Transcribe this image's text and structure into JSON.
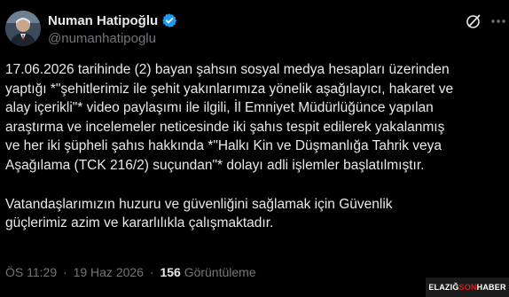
{
  "author": {
    "display_name": "Numan Hatipoğlu",
    "handle": "@numanhatipoglu",
    "verified_icon": "verified-badge-icon",
    "avatar": "profile-photo"
  },
  "actions": {
    "grok_icon": "grok-slash-circle-icon",
    "more_icon": "more-dots-icon"
  },
  "tweet": {
    "paragraph1": [
      "17.06.2026 tarihinde (2) bayan şahsın sosyal medya hesapları üzerinden",
      "yaptığı *\"şehitlerimiz ile şehit yakınlarımıza yönelik aşağılayıcı, hakaret ve",
      "alay içerikli\"* video paylaşımı ile ilgili,  İl Emniyet  Müdürlüğünce yapılan",
      "araştırma ve incelemeler neticesinde iki şahıs tespit edilerek yakalanmış",
      "ve her iki şüpheli şahıs hakkında *\"Halkı Kin ve Düşmanlığa Tahrik veya",
      "Aşağılama (TCK 216/2) suçundan\"* dolayı adli işlemler başlatılmıştır."
    ],
    "paragraph2": [
      "Vatandaşlarımızın huzuru ve güvenliğini sağlamak için Güvenlik",
      "güçlerimiz azim ve kararlılıkla çalışmaktadır."
    ]
  },
  "meta": {
    "time": "ÖS 11:29",
    "separator": "·",
    "date": "19 Haz 2026",
    "views_count": "156",
    "views_label": "Görüntüleme"
  },
  "watermark": {
    "part1": "ELAZIĞ ",
    "part2": "SON",
    "part3": " HABER"
  },
  "colors": {
    "background": "#000000",
    "text": "#e7e9ea",
    "muted": "#71767b",
    "verified": "#1d9bf0",
    "watermark_accent": "#e01b1b"
  }
}
